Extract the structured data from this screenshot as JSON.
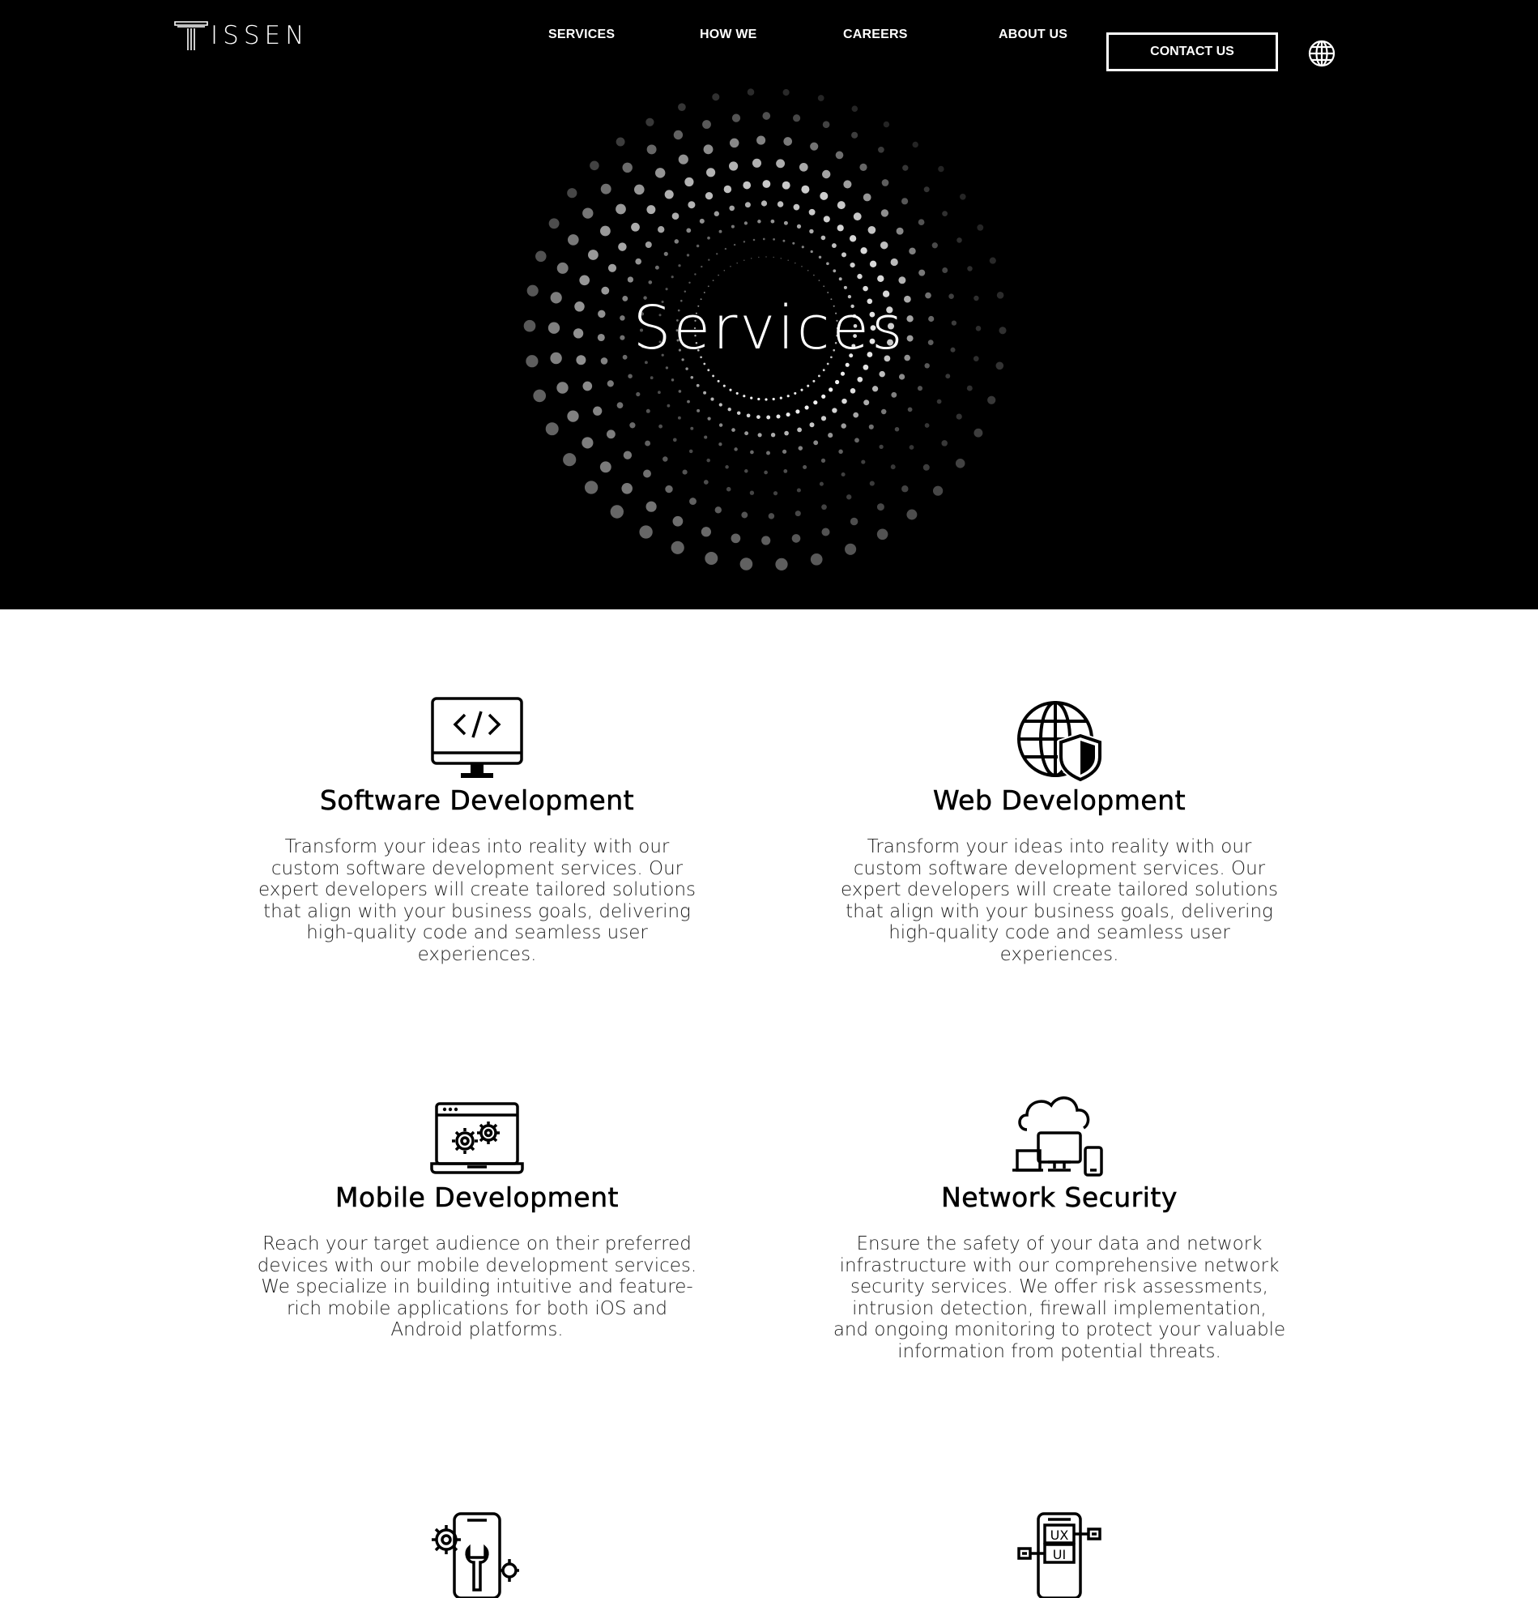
{
  "brand": {
    "logo_text": "ISSEN"
  },
  "nav": {
    "items": [
      {
        "label": "SERVICES"
      },
      {
        "label": "HOW WE"
      },
      {
        "label": "CAREERS"
      },
      {
        "label": "ABOUT US"
      }
    ],
    "contact_label": "CONTACT US",
    "language_icon": "globe-icon"
  },
  "hero": {
    "title": "Services"
  },
  "services": [
    {
      "icon": "code-monitor-icon",
      "title": "Software Development",
      "description": "Transform your ideas into reality with our custom software development services. Our expert developers will create tailored solutions that align with your business goals, delivering high-quality code and seamless user experiences."
    },
    {
      "icon": "globe-shield-icon",
      "title": "Web Development",
      "description": "Transform your ideas into reality with our custom software development services. Our expert developers will create tailored solutions that align with your business goals, delivering high-quality code and seamless user experiences."
    },
    {
      "icon": "laptop-gears-icon",
      "title": "Mobile Development",
      "description": "Reach your target audience on their preferred devices with our mobile development services. We specialize in building intuitive and feature-rich mobile applications for both iOS and Android platforms."
    },
    {
      "icon": "cloud-devices-icon",
      "title": "Network Security",
      "description": "Ensure the safety of your data and network infrastructure with our comprehensive network security services. We offer risk assessments, intrusion detection, firewall implementation, and ongoing monitoring to protect your valuable information from potential threats."
    },
    {
      "icon": "phone-wrench-gear-icon"
    },
    {
      "icon": "ux-ui-phone-icon",
      "labels": [
        "UX",
        "UI"
      ]
    }
  ],
  "colors": {
    "background": "#000000",
    "text": "#ffffff",
    "body_text": "#222222"
  }
}
